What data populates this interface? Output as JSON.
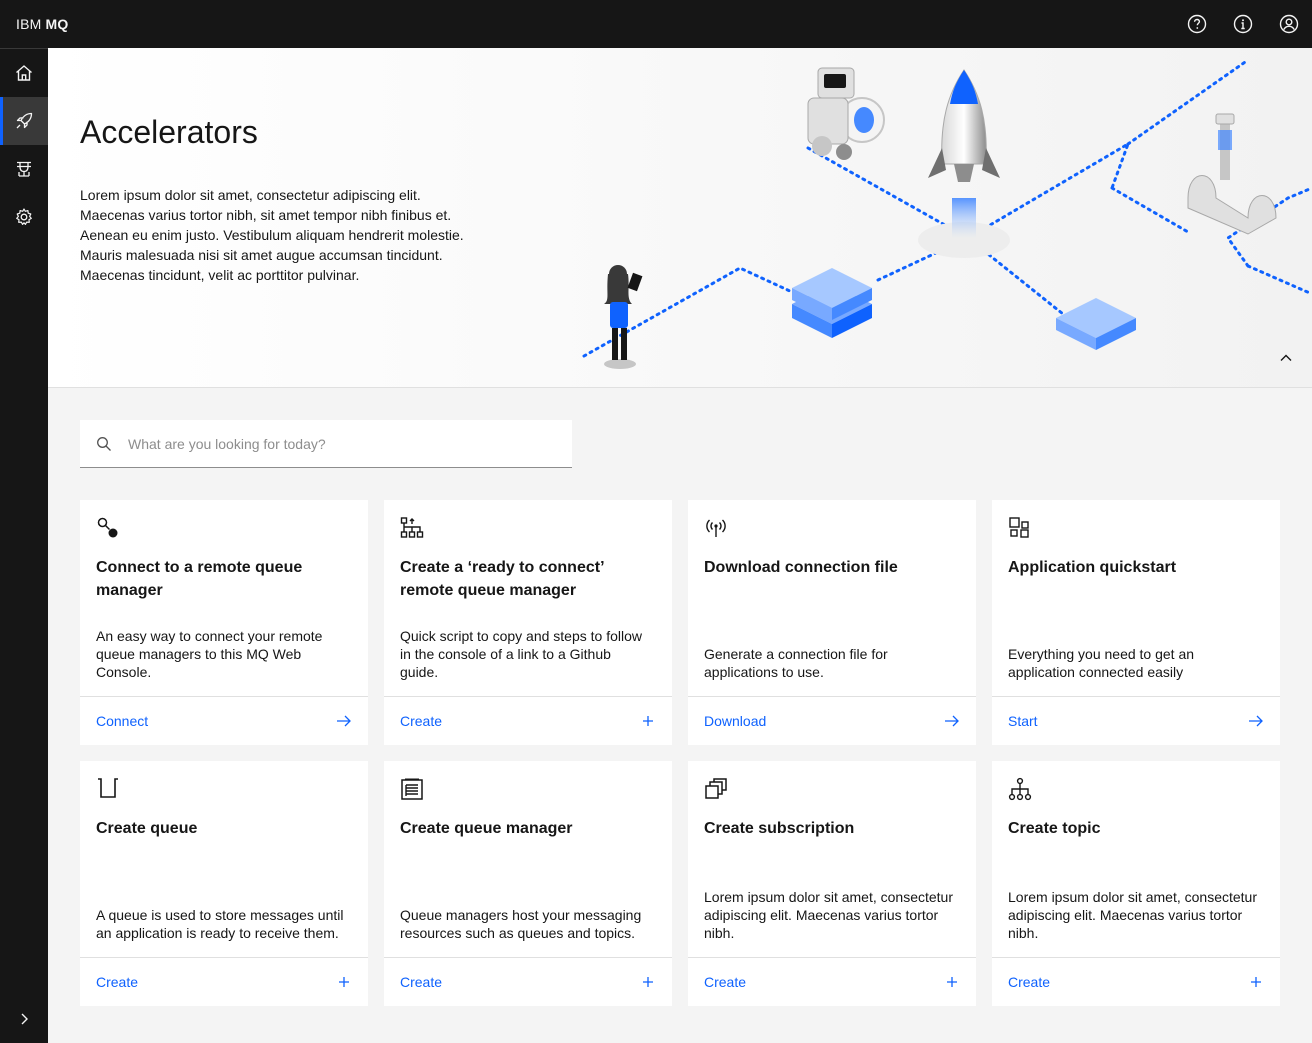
{
  "header": {
    "brand_prefix": "IBM",
    "brand_product": "MQ",
    "actions": [
      "help-icon",
      "info-icon",
      "user-avatar-icon"
    ]
  },
  "sidenav": {
    "items": [
      {
        "name": "home",
        "icon": "home-icon",
        "active": false
      },
      {
        "name": "accelerators",
        "icon": "rocket-icon",
        "active": true
      },
      {
        "name": "queue-managers",
        "icon": "gateway-icon",
        "active": false
      },
      {
        "name": "settings",
        "icon": "gear-icon",
        "active": false
      }
    ],
    "expand_icon": "chevron-right-icon"
  },
  "hero": {
    "title": "Accelerators",
    "description": "Lorem ipsum dolor sit amet, consectetur adipiscing elit.\nMaecenas varius tortor nibh, sit amet tempor nibh finibus et.\nAenean eu enim justo. Vestibulum aliquam hendrerit molestie.\nMauris malesuada nisi sit amet augue accumsan tincidunt.\nMaecenas tincidunt, velit ac porttitor pulvinar."
  },
  "search": {
    "placeholder": "What are you looking for today?",
    "value": ""
  },
  "colors": {
    "accent": "#0f62fe",
    "shell": "#161616",
    "background": "#f4f4f4"
  },
  "cards": [
    {
      "title": "Connect to a remote queue manager",
      "description": "An easy way to connect your remote queue managers to this MQ Web Console.",
      "action": "Connect",
      "action_icon": "arrow-right-icon",
      "icon": "connect-icon"
    },
    {
      "title": "Create a ‘ready to connect’ remote queue manager",
      "description": "Quick script to copy and steps to follow in the console of a link to a Github guide.",
      "action": "Create",
      "action_icon": "add-icon",
      "icon": "flow-icon"
    },
    {
      "title": "Download connection file",
      "description": "Generate a connection file for applications to use.",
      "action": "Download",
      "action_icon": "arrow-right-icon",
      "icon": "antenna-icon"
    },
    {
      "title": "Application quickstart",
      "description": "Everything you need to get an application connected easily",
      "action": "Start",
      "action_icon": "arrow-right-icon",
      "icon": "apps-icon"
    },
    {
      "title": "Create queue",
      "description": "A queue is used to store messages until an application is ready to receive them.",
      "action": "Create",
      "action_icon": "add-icon",
      "icon": "queue-icon"
    },
    {
      "title": "Create queue manager",
      "description": "Queue managers host your messaging resources such as queues and topics.",
      "action": "Create",
      "action_icon": "add-icon",
      "icon": "document-icon"
    },
    {
      "title": "Create subscription",
      "description": "Lorem ipsum dolor sit amet, consectetur adipiscing elit. Maecenas varius tortor nibh.",
      "action": "Create",
      "action_icon": "add-icon",
      "icon": "copy-icon"
    },
    {
      "title": "Create topic",
      "description": "Lorem ipsum dolor sit amet, consectetur adipiscing elit. Maecenas varius tortor nibh.",
      "action": "Create",
      "action_icon": "add-icon",
      "icon": "tree-icon"
    }
  ]
}
